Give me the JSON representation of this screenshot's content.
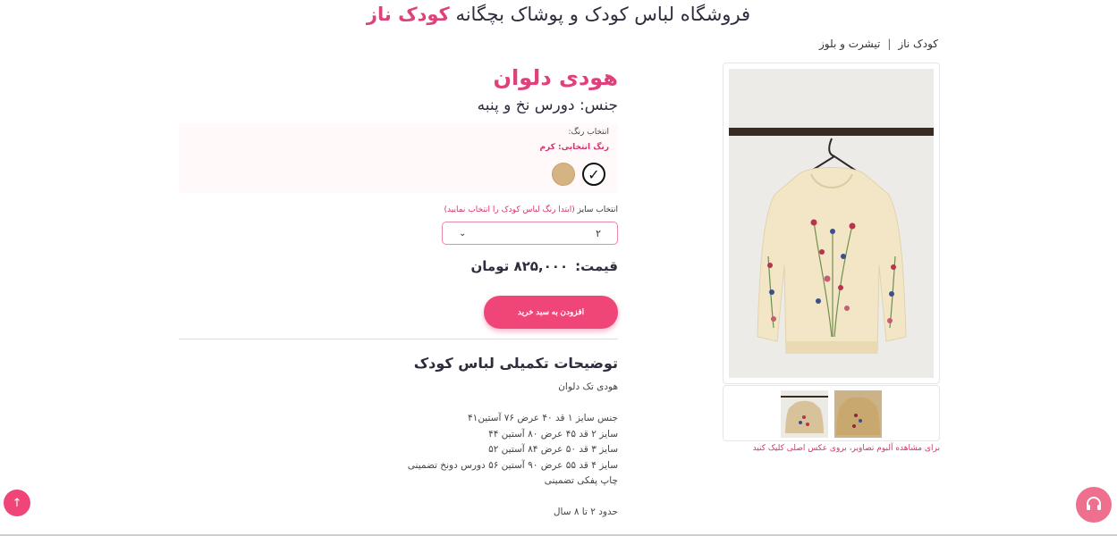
{
  "header": {
    "title_prefix": "فروشگاه لباس کودک و پوشاک بچگانه",
    "title_brand": "کودک ناز"
  },
  "breadcrumb": {
    "items": [
      "کودک ناز",
      "تیشرت و بلوز"
    ],
    "separator": "|"
  },
  "gallery": {
    "note": "برای مشاهده آلبوم تصاویر، بروی عکس اصلی کلیک کنید"
  },
  "product": {
    "name": "هودی دلوان",
    "material": "جنس: دورس نخ و پنبه",
    "color_label": "انتخاب رنگ:",
    "color_selected": "رنگ انتخابی: کرم",
    "swatches": [
      {
        "name": "checked",
        "glyph": "✓"
      },
      {
        "name": "cream",
        "color": "#d6b383"
      }
    ],
    "size_label": "انتخاب سایز",
    "size_hint": "(ابتدا رنگ لباس کودک را انتخاب نمایید)",
    "size_value": "۲",
    "price_label": "قیمت:",
    "price_value": "۸۲۵,۰۰۰ تومان",
    "add_to_cart": "افزودن به سبد خرید"
  },
  "description": {
    "title": "توضیحات تکمیلی لباس کودک",
    "lines": [
      "هودی تک دلوان",
      "",
      "جنس سایز ۱ قد ۴۰ عرض ۷۶ آستین۴۱",
      "سایز ۲ قد ۴۵ عرض ۸۰ آستین ۴۴",
      "سایز ۳ قد ۵۰ عرض ۸۴ آستین ۵۲",
      "سایز ۴ قد ۵۵ عرض ۹۰ آستین ۵۶ دورس دونخ تضمینی",
      "چاپ پفکی تضمینی",
      "",
      "حدود ۲ تا ۸ سال"
    ]
  },
  "floating": {
    "scroll_top_icon": "↑"
  },
  "colors": {
    "accent": "#e0407b",
    "button": "#ef4677"
  }
}
